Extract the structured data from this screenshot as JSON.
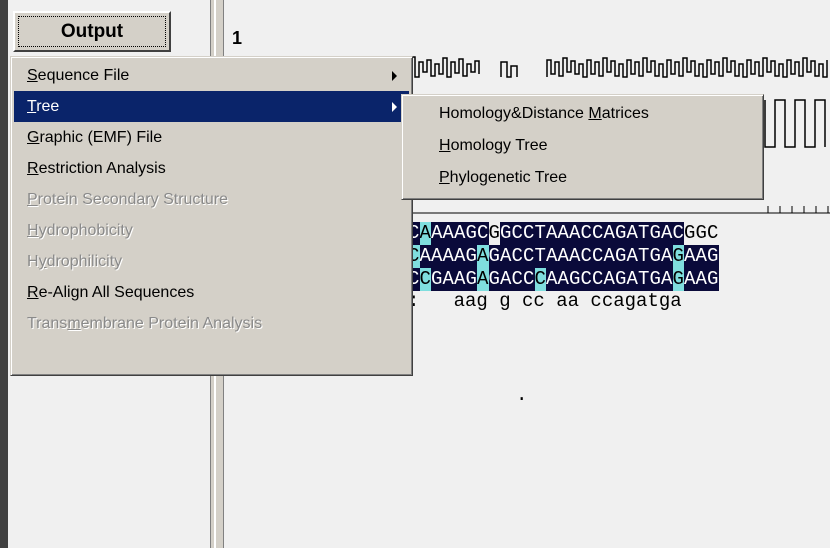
{
  "toolbar": {
    "output_button": "Output"
  },
  "view": {
    "page_number": "1"
  },
  "menu": {
    "items": [
      {
        "pre": "",
        "ul": "S",
        "post": "equence File",
        "submenu": true,
        "enabled": true
      },
      {
        "pre": "",
        "ul": "T",
        "post": "ree",
        "submenu": true,
        "enabled": true,
        "selected": true
      },
      {
        "pre": "",
        "ul": "G",
        "post": "raphic (EMF) File",
        "enabled": true
      },
      {
        "pre": "",
        "ul": "R",
        "post": "estriction Analysis",
        "enabled": true
      },
      {
        "pre": "",
        "ul": "P",
        "post": "rotein Secondary Structure",
        "enabled": false
      },
      {
        "pre": "",
        "ul": "H",
        "post": "ydrophobicity",
        "enabled": false
      },
      {
        "pre": "H",
        "ul": "y",
        "post": "drophilicity",
        "enabled": false
      },
      {
        "pre": "",
        "ul": "R",
        "post": "e-Align All Sequences",
        "enabled": true
      },
      {
        "pre": "Trans",
        "ul": "m",
        "post": "embrane Protein Analysis",
        "enabled": false
      }
    ]
  },
  "submenu": {
    "items": [
      {
        "pre": "Homology&Distance ",
        "ul": "M",
        "post": "atrices"
      },
      {
        "pre": "",
        "ul": "H",
        "post": "omology Tree"
      },
      {
        "pre": "",
        "ul": "P",
        "post": "hylogenetic Tree"
      }
    ]
  },
  "alignment": {
    "rows": [
      "CAAAAGCGGCCTAAACCAGATGACGGC",
      "CAAAAGAGACCTAAACCAGATGAGAAG",
      "CCGAAGAGACCCAAGCCAGATGAGAAG"
    ],
    "shading": [
      "ntnnnnnwnnnnnnnnnnnnnnnnwww",
      "tnnnnntnnnnnnnnnnnnnnnntnnn",
      "ntnnnntnnnntnnnnnnnnnnntnnn"
    ],
    "consensus": ":   aag g cc aa ccagatga",
    "dot": "."
  },
  "colors": {
    "highlight": "#0a246a",
    "identical": "#0a0a3a",
    "similar": "#7fdede"
  }
}
